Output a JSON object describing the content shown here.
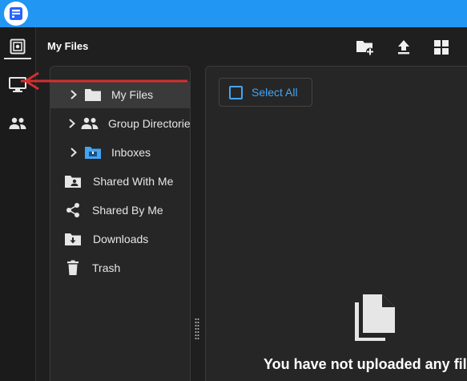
{
  "header": {
    "title": "My Files",
    "actions": [
      {
        "icon": "new-folder-icon"
      },
      {
        "icon": "upload-icon"
      },
      {
        "icon": "grid-view-icon"
      }
    ]
  },
  "rail": {
    "items": [
      {
        "icon": "vault-icon",
        "active": true
      },
      {
        "icon": "monitor-icon",
        "active": false
      },
      {
        "icon": "people-icon",
        "active": false
      }
    ]
  },
  "tree": {
    "items": [
      {
        "label": "My Files",
        "icon": "folder-icon",
        "expandable": true,
        "selected": true
      },
      {
        "label": "Group Directories",
        "icon": "group-icon",
        "expandable": true,
        "selected": false
      },
      {
        "label": "Inboxes",
        "icon": "inbox-icon",
        "expandable": true,
        "selected": false
      },
      {
        "label": "Shared With Me",
        "icon": "shared-folder-icon",
        "expandable": false,
        "selected": false
      },
      {
        "label": "Shared By Me",
        "icon": "share-icon",
        "expandable": false,
        "selected": false
      },
      {
        "label": "Downloads",
        "icon": "download-folder-icon",
        "expandable": false,
        "selected": false
      },
      {
        "label": "Trash",
        "icon": "trash-icon",
        "expandable": false,
        "selected": false
      }
    ]
  },
  "content": {
    "select_all_label": "Select All",
    "empty_message": "You have not uploaded any files"
  },
  "colors": {
    "topbar": "#2196f3",
    "accent": "#42a5f5",
    "annotation": "#d32f2f",
    "background": "#1f1f1f"
  }
}
